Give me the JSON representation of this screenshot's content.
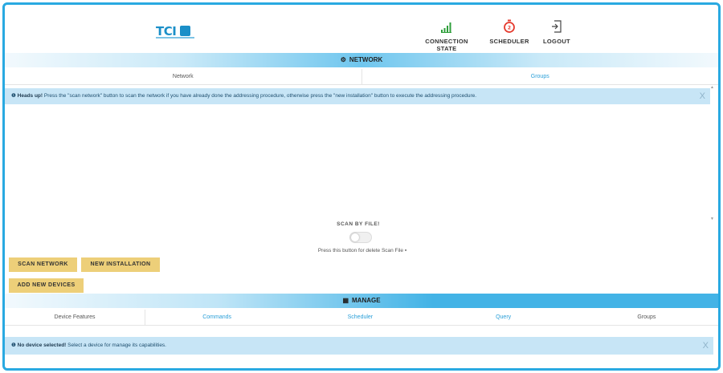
{
  "header": {
    "logo_text": "TCI",
    "nav": [
      {
        "label": "CONNECTION STATE",
        "icon": "signal-bars-icon",
        "color": "#2e9e3a"
      },
      {
        "label": "SCHEDULER",
        "icon": "stopwatch-icon",
        "color": "#e53a2e"
      },
      {
        "label": "LOGOUT",
        "icon": "logout-icon",
        "color": "#444444"
      }
    ]
  },
  "network": {
    "title": "NETWORK",
    "tabs": [
      "Network",
      "Groups"
    ],
    "alert": {
      "strong": "Heads up!",
      "text": " Press the \"scan network\" button to scan the network if you have already done the addressing procedure, otherwise press the \"new installation\" button to execute the addressing procedure.",
      "close": "X"
    },
    "scan_by_file_label": "SCAN BY FILE!",
    "scan_hint": "Press this button for delete Scan File",
    "buttons": {
      "scan_network": "SCAN NETWORK",
      "new_installation": "NEW INSTALLATION",
      "add_new_devices": "ADD NEW DEVICES"
    }
  },
  "manage": {
    "title": "MANAGE",
    "tabs": [
      "Device Features",
      "Commands",
      "Scheduler",
      "Query",
      "Groups"
    ],
    "alert": {
      "strong": "No device selected!",
      "text": " Select a device for manage its capabilities.",
      "close": "X"
    }
  },
  "colors": {
    "accent": "#29a9e1",
    "button": "#edcf79",
    "alert_bg": "#c7e5f6"
  }
}
